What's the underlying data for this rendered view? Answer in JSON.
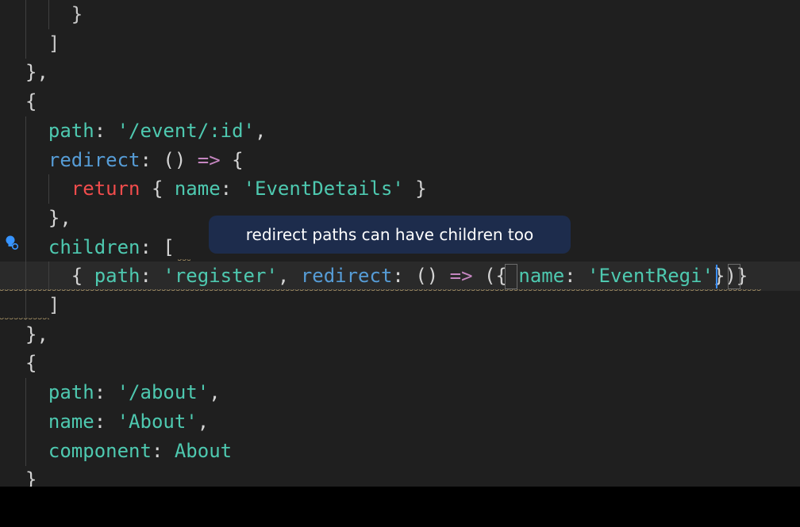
{
  "editor": {
    "lines": [
      {
        "indent": "    ",
        "tokens": [
          {
            "t": "}",
            "c": "brace"
          }
        ]
      },
      {
        "indent": "  ",
        "tokens": [
          {
            "t": "]",
            "c": "brace"
          }
        ]
      },
      {
        "indent": "",
        "tokens": [
          {
            "t": "},",
            "c": "plain"
          }
        ]
      },
      {
        "indent": "",
        "tokens": [
          {
            "t": "{",
            "c": "plain"
          }
        ]
      },
      {
        "indent": "  ",
        "tokens": [
          {
            "t": "path",
            "c": "prop"
          },
          {
            "t": ": ",
            "c": "plain"
          },
          {
            "t": "'/event/:id'",
            "c": "str"
          },
          {
            "t": ",",
            "c": "plain"
          }
        ]
      },
      {
        "indent": "  ",
        "tokens": [
          {
            "t": "redirect",
            "c": "key-blue"
          },
          {
            "t": ": ",
            "c": "plain"
          },
          {
            "t": "()",
            "c": "plain"
          },
          {
            "t": " => ",
            "c": "arrow"
          },
          {
            "t": "{",
            "c": "plain"
          }
        ]
      },
      {
        "indent": "    ",
        "tokens": [
          {
            "t": "return",
            "c": "kw"
          },
          {
            "t": " { ",
            "c": "plain"
          },
          {
            "t": "name",
            "c": "prop"
          },
          {
            "t": ": ",
            "c": "plain"
          },
          {
            "t": "'EventDetails'",
            "c": "str"
          },
          {
            "t": " }",
            "c": "plain"
          }
        ]
      },
      {
        "indent": "  ",
        "tokens": [
          {
            "t": "},",
            "c": "plain"
          }
        ]
      },
      {
        "indent": "  ",
        "tokens": [
          {
            "t": "children",
            "c": "prop"
          },
          {
            "t": ": ",
            "c": "plain"
          },
          {
            "t": "[",
            "c": "plain"
          }
        ]
      },
      {
        "indent": "    ",
        "tokens": [
          {
            "t": "{ ",
            "c": "plain"
          },
          {
            "t": "path",
            "c": "prop"
          },
          {
            "t": ": ",
            "c": "plain"
          },
          {
            "t": "'register'",
            "c": "str"
          },
          {
            "t": ", ",
            "c": "plain"
          },
          {
            "t": "redirect",
            "c": "key-blue"
          },
          {
            "t": ": ",
            "c": "plain"
          },
          {
            "t": "()",
            "c": "plain"
          },
          {
            "t": " => ",
            "c": "arrow"
          },
          {
            "t": "({ ",
            "c": "plain"
          },
          {
            "t": "name",
            "c": "prop"
          },
          {
            "t": ": ",
            "c": "plain"
          },
          {
            "t": "'EventRegi'",
            "c": "str"
          },
          {
            "t": "})}",
            "c": "plain"
          }
        ]
      },
      {
        "indent": "  ",
        "tokens": [
          {
            "t": "]",
            "c": "brace"
          }
        ]
      },
      {
        "indent": "",
        "tokens": [
          {
            "t": "},",
            "c": "plain"
          }
        ]
      },
      {
        "indent": "",
        "tokens": [
          {
            "t": "{",
            "c": "plain"
          }
        ]
      },
      {
        "indent": "  ",
        "tokens": [
          {
            "t": "path",
            "c": "prop"
          },
          {
            "t": ": ",
            "c": "plain"
          },
          {
            "t": "'/about'",
            "c": "str"
          },
          {
            "t": ",",
            "c": "plain"
          }
        ]
      },
      {
        "indent": "  ",
        "tokens": [
          {
            "t": "name",
            "c": "prop"
          },
          {
            "t": ": ",
            "c": "plain"
          },
          {
            "t": "'About'",
            "c": "str"
          },
          {
            "t": ",",
            "c": "plain"
          }
        ]
      },
      {
        "indent": "  ",
        "tokens": [
          {
            "t": "component",
            "c": "prop"
          },
          {
            "t": ": ",
            "c": "plain"
          },
          {
            "t": "About",
            "c": "ident"
          }
        ]
      },
      {
        "indent": "",
        "tokens": [
          {
            "t": "}",
            "c": "plain"
          }
        ]
      }
    ],
    "current_line_index": 9
  },
  "caption": {
    "text": "redirect paths can have children too"
  },
  "icons": {
    "gutter": "lightbulb-icon"
  },
  "colors": {
    "editor_bg": "#1f1f1f",
    "caption_bg": "#1d2c4c",
    "squiggle": "#d7ba7d",
    "cursor": "#3c8fff"
  }
}
